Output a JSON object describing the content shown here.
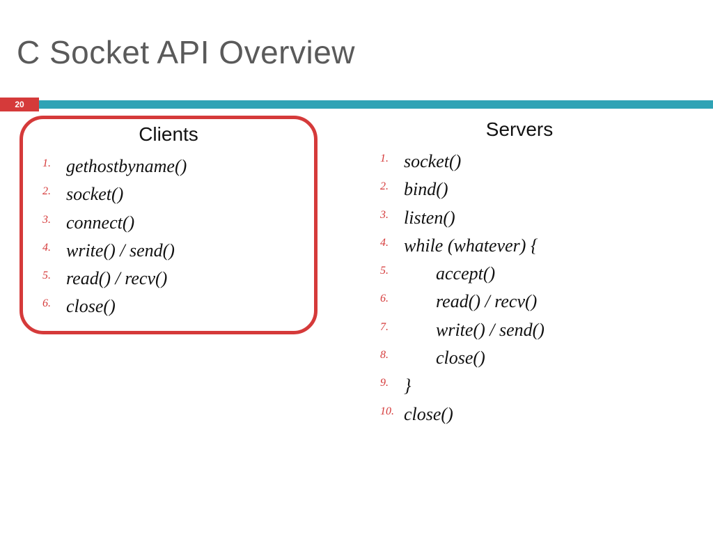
{
  "title": "C Socket API Overview",
  "slide_number": "20",
  "columns": {
    "left": {
      "heading": "Clients",
      "items": [
        {
          "n": "1.",
          "text": "gethostbyname()"
        },
        {
          "n": "2.",
          "text": "socket()"
        },
        {
          "n": "3.",
          "text": "connect()"
        },
        {
          "n": "4.",
          "text": "write() / send()"
        },
        {
          "n": "5.",
          "text": "read() / recv()"
        },
        {
          "n": "6.",
          "text": "close()"
        }
      ]
    },
    "right": {
      "heading": "Servers",
      "items": [
        {
          "n": "1.",
          "text": "socket()"
        },
        {
          "n": "2.",
          "text": "bind()"
        },
        {
          "n": "3.",
          "text": "listen()"
        },
        {
          "n": "4.",
          "text": "while (whatever) {"
        },
        {
          "n": "5.",
          "text": "accept()",
          "indent": true
        },
        {
          "n": "6.",
          "text": "read() / recv()",
          "indent": true
        },
        {
          "n": "7.",
          "text": "write() / send()",
          "indent": true
        },
        {
          "n": "8.",
          "text": "close()",
          "indent": true
        },
        {
          "n": "9.",
          "text": "}"
        },
        {
          "n": "10.",
          "text": "close()"
        }
      ]
    }
  }
}
